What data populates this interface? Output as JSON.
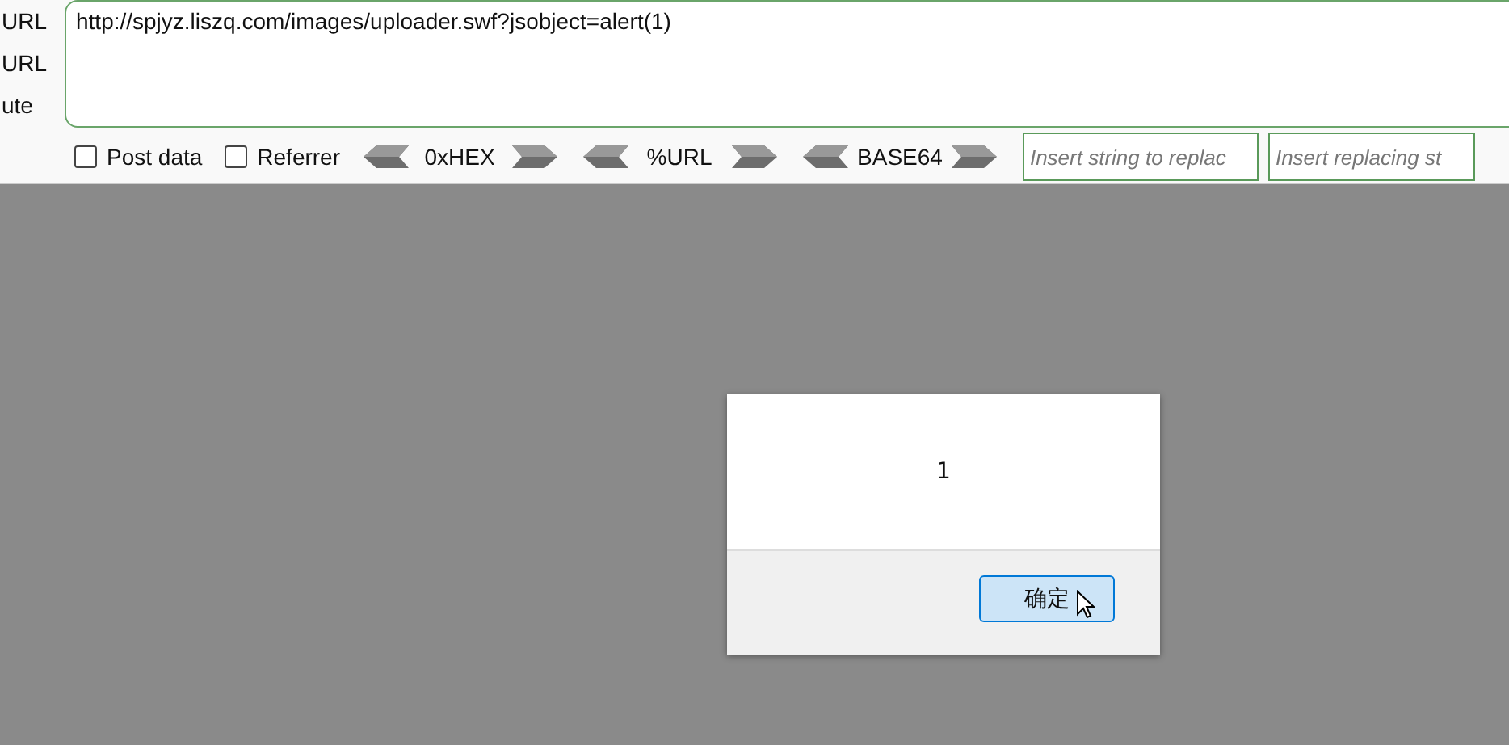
{
  "side_labels": [
    "URL",
    "URL",
    "ute"
  ],
  "url_field": {
    "value": "http://spjyz.liszq.com/images/uploader.swf?jsobject=alert(1)"
  },
  "options": [
    {
      "label": "Post data",
      "checked": false
    },
    {
      "label": "Referrer",
      "checked": false
    }
  ],
  "encoders": [
    "0xHEX",
    "%URL",
    "BASE64"
  ],
  "replace_fields": [
    {
      "placeholder": "Insert string to replac"
    },
    {
      "placeholder": "Insert replacing st"
    }
  ],
  "alert_dialog": {
    "message": "1",
    "button": "确定"
  }
}
